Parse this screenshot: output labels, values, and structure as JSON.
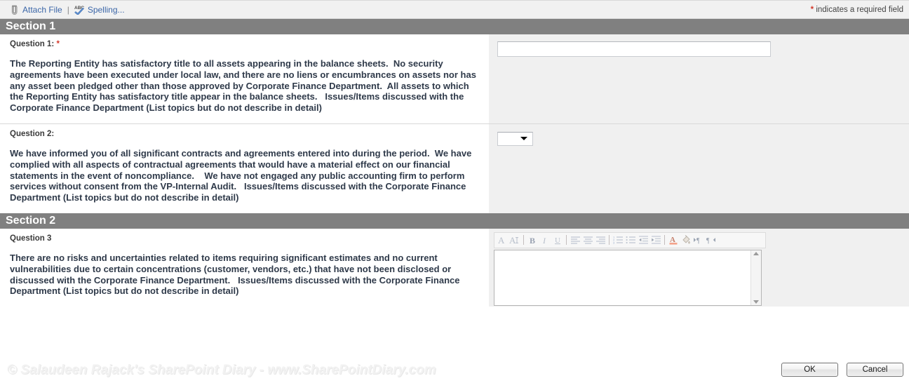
{
  "toolbar": {
    "attach_file_label": "Attach File",
    "separator": "|",
    "spelling_label": "Spelling...",
    "required_star": "*",
    "required_note": " indicates a required field",
    "attach_icon": "paperclip-icon",
    "spelling_icon": "abc-checkmark-icon"
  },
  "sections": [
    {
      "title": "Section 1",
      "questions": [
        {
          "label": "Question 1:",
          "required_star": "*",
          "text": "The Reporting Entity has satisfactory title to all assets appearing in the balance sheets.  No security agreements have been executed under local law, and there are no liens or encumbrances on assets nor has any asset been pledged other than those approved by Corporate Finance Department.  All assets to which the Reporting Entity has satisfactory title appear in the balance sheets.   Issues/Items discussed with the Corporate Finance Department (List topics but do not describe in detail)",
          "control": "text-input",
          "value": "",
          "placeholder": ""
        },
        {
          "label": "Question 2:",
          "required_star": "",
          "text": "We have informed you of all significant contracts and agreements entered into during the period.  We have complied with all aspects of contractual agreements that would have a material effect on our financial statements in the event of noncompliance.    We have not engaged any public accounting firm to perform services without consent from the VP-Internal Audit.   Issues/Items discussed with the Corporate Finance Department (List topics but do not describe in detail)",
          "control": "dropdown",
          "value": "",
          "options": []
        }
      ]
    },
    {
      "title": "Section 2",
      "questions": [
        {
          "label": "Question 3",
          "required_star": "",
          "text": "There are no risks and uncertainties related to items requiring significant estimates and no current vulnerabilities due to certain concentrations (customer, vendors, etc.) that have not been disclosed or discussed with the Corporate Finance Department.   Issues/Items discussed with the Corporate Finance Department (List topics but do not describe in detail)",
          "control": "rich-text",
          "value": ""
        }
      ]
    }
  ],
  "rich_text_toolbar": {
    "buttons": [
      {
        "name": "font-grow-icon",
        "glyph": "A"
      },
      {
        "name": "font-shrink-icon",
        "glyph": "A"
      },
      {
        "name": "bold-icon",
        "glyph": "B"
      },
      {
        "name": "italic-icon",
        "glyph": "I"
      },
      {
        "name": "underline-icon",
        "glyph": "U"
      },
      {
        "name": "align-left-icon",
        "glyph": ""
      },
      {
        "name": "align-center-icon",
        "glyph": ""
      },
      {
        "name": "align-right-icon",
        "glyph": ""
      },
      {
        "name": "numbered-list-icon",
        "glyph": ""
      },
      {
        "name": "bulleted-list-icon",
        "glyph": ""
      },
      {
        "name": "outdent-icon",
        "glyph": ""
      },
      {
        "name": "indent-icon",
        "glyph": ""
      },
      {
        "name": "font-color-icon",
        "glyph": "A"
      },
      {
        "name": "highlight-color-icon",
        "glyph": ""
      },
      {
        "name": "ltr-direction-icon",
        "glyph": ""
      },
      {
        "name": "rtl-direction-icon",
        "glyph": ""
      }
    ]
  },
  "buttons": {
    "ok_label": "OK",
    "cancel_label": "Cancel"
  },
  "watermark": "© Salaudeen Rajack's SharePoint Diary - www.SharePointDiary.com",
  "colors": {
    "section_bar": "#808080",
    "field_background": "#f0f0f0",
    "toolbar_background": "#f1f1f1",
    "link": "#3b66a8",
    "required_red": "#d33a2c",
    "question_text": "#2f3a4a"
  }
}
